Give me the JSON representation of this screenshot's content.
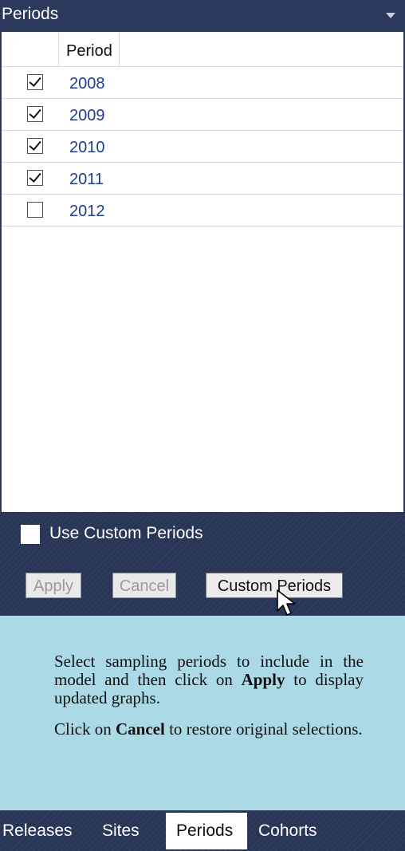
{
  "titlebar": {
    "title": "Periods"
  },
  "grid": {
    "column_header": "Period",
    "rows": [
      {
        "value": "2008",
        "checked": true
      },
      {
        "value": "2009",
        "checked": true
      },
      {
        "value": "2010",
        "checked": true
      },
      {
        "value": "2011",
        "checked": true
      },
      {
        "value": "2012",
        "checked": false
      }
    ]
  },
  "controls": {
    "use_custom_label": "Use Custom Periods",
    "apply_label": "Apply",
    "cancel_label": "Cancel",
    "custom_periods_label": "Custom Periods"
  },
  "info": {
    "p1_before": "Select sampling periods to include in the model and then click on ",
    "p1_bold": "Apply",
    "p1_after": " to display updated graphs.",
    "p2_before": "Click on ",
    "p2_bold": "Cancel",
    "p2_after": " to restore original selections."
  },
  "tabs": [
    {
      "label": "Releases",
      "active": false
    },
    {
      "label": "Sites",
      "active": false
    },
    {
      "label": "Periods",
      "active": true
    },
    {
      "label": "Cohorts",
      "active": false
    }
  ],
  "colors": {
    "header_bg": "#2b3a5c",
    "controls_bg": "#273556",
    "info_bg": "#acd9e6",
    "period_text": "#1c3d8f"
  }
}
